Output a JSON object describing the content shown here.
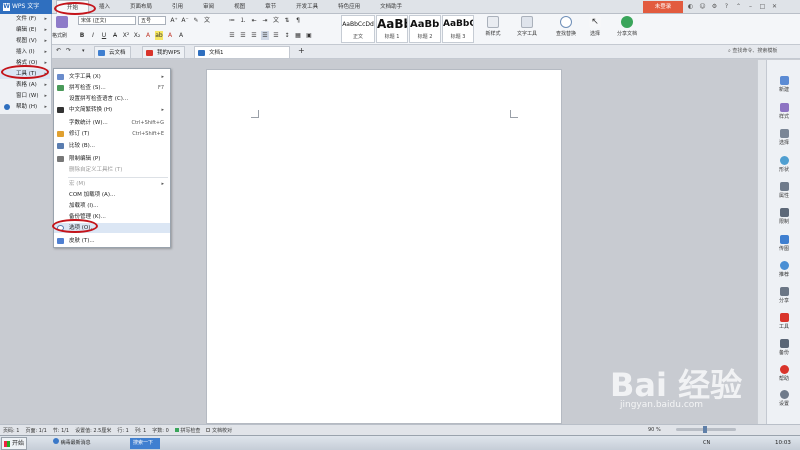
{
  "app": {
    "name": "WPS 文字",
    "login": "未登录"
  },
  "menu_tabs": [
    "开始",
    "插入",
    "页面布局",
    "引用",
    "审阅",
    "视图",
    "章节",
    "开发工具",
    "特色应用",
    "文档助手"
  ],
  "ribbon": {
    "font_name": "宋体 (正文)",
    "font_size": "五号",
    "format_painter": "格式刷",
    "styles": [
      {
        "sample": "AaBbCcDd",
        "name": "正文"
      },
      {
        "sample": "AaBb",
        "name": "标题 1"
      },
      {
        "sample": "AaBb(",
        "name": "标题 2"
      },
      {
        "sample": "AaBbC",
        "name": "标题 3"
      }
    ],
    "new_style": "新样式",
    "text_tool": "文字工具",
    "find_replace": "查找替换",
    "select": "选择",
    "share_doc": "分享文档"
  },
  "doc_tabs": [
    "云文档",
    "我的WPS",
    "文档1"
  ],
  "search_hint": "查找命令、搜索模板",
  "app_menu": [
    {
      "label": "文件 (F)"
    },
    {
      "label": "编辑 (E)"
    },
    {
      "label": "视图 (V)"
    },
    {
      "label": "插入 (I)"
    },
    {
      "label": "格式 (O)"
    },
    {
      "label": "工具 (T)"
    },
    {
      "label": "表格 (A)"
    },
    {
      "label": "窗口 (W)"
    },
    {
      "label": "帮助 (H)"
    }
  ],
  "tools_menu": [
    {
      "label": "文字工具 (X)",
      "shortcut": "",
      "disabled": false
    },
    {
      "label": "拼写检查 (S)...",
      "shortcut": "F7",
      "disabled": false
    },
    {
      "label": "设置拼写检查语言 (C)...",
      "shortcut": "",
      "disabled": false
    },
    {
      "label": "中文简繁转换 (H)",
      "shortcut": "",
      "disabled": false
    },
    {
      "label": "字数统计 (W)...",
      "shortcut": "Ctrl+Shift+G",
      "disabled": false
    },
    {
      "label": "修订 (T)",
      "shortcut": "Ctrl+Shift+E",
      "disabled": false
    },
    {
      "label": "比较 (B)...",
      "shortcut": "",
      "disabled": false
    },
    {
      "label": "限制编辑 (P)",
      "shortcut": "",
      "disabled": false
    },
    {
      "label": "删除自定义工具栏 (T)",
      "shortcut": "",
      "disabled": true
    },
    {
      "label": "宏 (M)",
      "shortcut": "",
      "disabled": true
    },
    {
      "label": "COM 加载项 (A)...",
      "shortcut": "",
      "disabled": false
    },
    {
      "label": "加载项 (I)...",
      "shortcut": "",
      "disabled": false
    },
    {
      "label": "备份管理 (K)...",
      "shortcut": "",
      "disabled": false
    },
    {
      "label": "选项 (O)...",
      "shortcut": "",
      "disabled": false
    },
    {
      "label": "皮肤 (T)...",
      "shortcut": "",
      "disabled": false
    }
  ],
  "sidebar": [
    "新建",
    "样式",
    "选择",
    "形状",
    "属性",
    "限制",
    "传图",
    "推荐",
    "分享",
    "工具",
    "备份",
    "帮助",
    "设置"
  ],
  "status": [
    "页码: 1",
    "页面: 1/1",
    "节: 1/1",
    "设置值: 2.5厘米",
    "行: 1",
    "列: 1",
    "字数: 0",
    "拼写检查",
    "文档校对"
  ],
  "zoom": "90 %",
  "taskbar": {
    "start": "开始",
    "item1": "病毒最新消息",
    "item2": "搜索一下",
    "ime": "CN",
    "clock": "10:03"
  },
  "watermark": {
    "main": "Bai 经验",
    "sub": "jingyan.baidu.com"
  },
  "colors": {
    "accent": "#2f6fbf",
    "highlight_ring": "#c4141a",
    "login": "#e25b3f"
  }
}
